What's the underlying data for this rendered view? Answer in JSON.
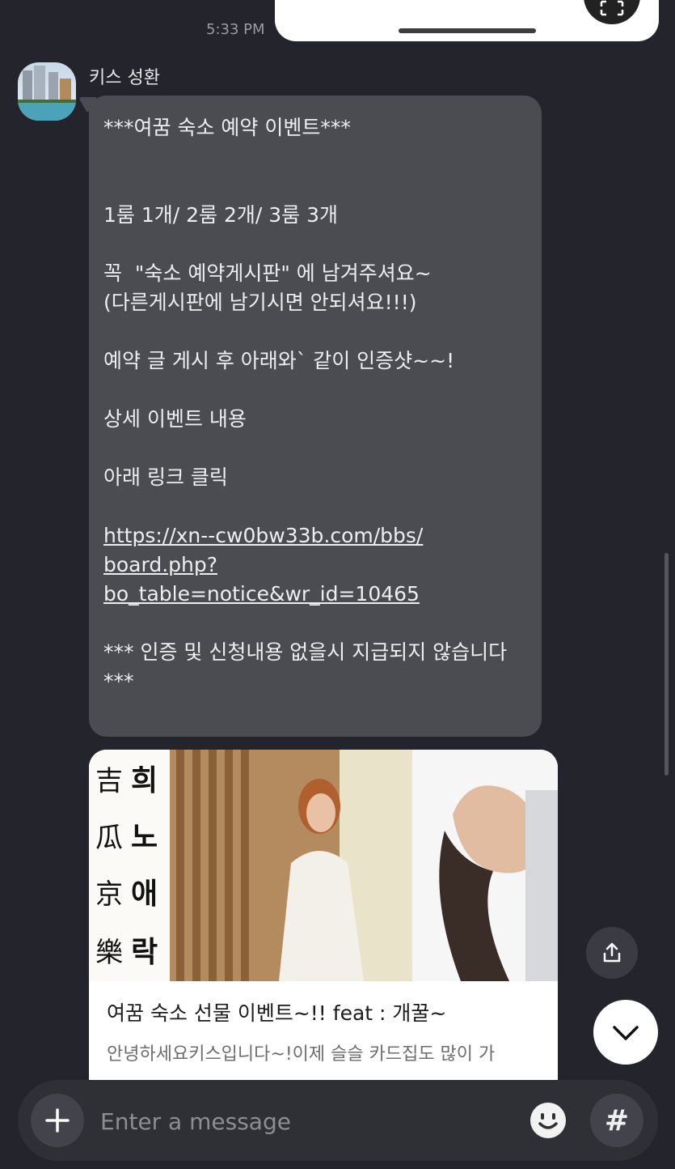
{
  "chat": {
    "prev_time": "5:33 PM",
    "sender_name": "키스 성환",
    "message_lines": [
      "***여꿈 숙소 예약 이벤트***",
      "",
      "",
      "1룸 1개/ 2룸 2개/ 3룸 3개",
      "",
      "꼭  \"숙소 예약게시판\" 에 남겨주셔요~",
      "(다른게시판에 남기시면 안되셔요!!!)",
      "",
      "예약 글 게시 후 아래와` 같이 인증샷~~!",
      "",
      "상세 이벤트 내용",
      "",
      "아래 링크 클릭",
      ""
    ],
    "link_lines": [
      "https://xn--cw0bw33b.com/bbs/",
      "board.php?",
      "bo_table=notice&wr_id=10465"
    ],
    "footer_lines": [
      "",
      "*** 인증 및 신청내용 없을시 지급되지 않습니다",
      "***"
    ]
  },
  "link_card": {
    "title": "여꿈 숙소 선물 이벤트~!! feat : 개꿀~",
    "description": "안녕하세요키스입니다~!이제 슬슬 카드집도 많이 가",
    "image_text_col1": [
      "吉",
      "瓜",
      "京",
      "樂"
    ],
    "image_text_col2": [
      "희",
      "노",
      "애",
      "락"
    ]
  },
  "input": {
    "placeholder": "Enter a message"
  },
  "icons": {
    "share": "share-icon",
    "scroll_down": "chevron-down-icon",
    "plus": "plus-icon",
    "emoji": "emoji-icon",
    "hash": "#"
  },
  "colors": {
    "background": "#24252c",
    "bubble": "#4a4c52",
    "input_bar": "#2f3036"
  }
}
